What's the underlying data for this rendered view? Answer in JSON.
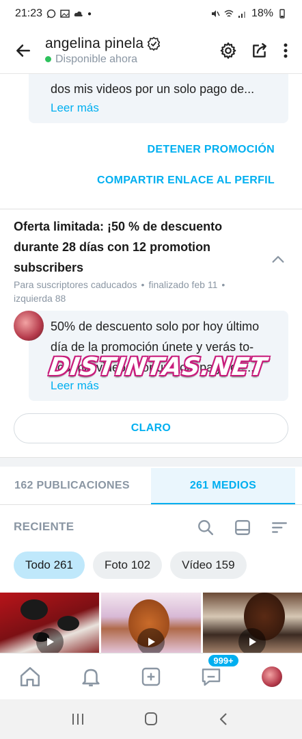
{
  "status_bar": {
    "time": "21:23",
    "battery": "18%"
  },
  "header": {
    "name": "angelina pinela",
    "status": "Disponible ahora"
  },
  "top_card": {
    "text": "dos mis videos por un solo pago de...",
    "read_more": "Leer más"
  },
  "actions": {
    "stop_promotion": "DETENER PROMOCIÓN",
    "share_link": "COMPARTIR ENLACE AL PERFIL"
  },
  "promo": {
    "title": "Oferta limitada: ¡50 % de descuento durante 28 días con 12 promotion subscribers",
    "meta_audience": "Para suscriptores caducados",
    "meta_ended": "finalizado feb 11",
    "meta_left": "izquierda 88",
    "text_line1": "50% de descuento solo por hoy último",
    "text_line2": "día de la promoción únete y verás to-",
    "text_line3": "dos mis videos por un solo pago de...",
    "read_more": "Leer más",
    "watermark": "DISTINTAS.NET",
    "clear_button": "CLARO"
  },
  "tabs": {
    "posts": "162 PUBLICACIONES",
    "media": "261 MEDIOS"
  },
  "filter": {
    "sort_label": "RECIENTE"
  },
  "chips": {
    "all": "Todo 261",
    "photo": "Foto 102",
    "video": "Vídeo 159"
  },
  "bottom_nav": {
    "messages_badge": "999+"
  },
  "colors": {
    "accent": "#00aff0",
    "online": "#2ec25d"
  }
}
